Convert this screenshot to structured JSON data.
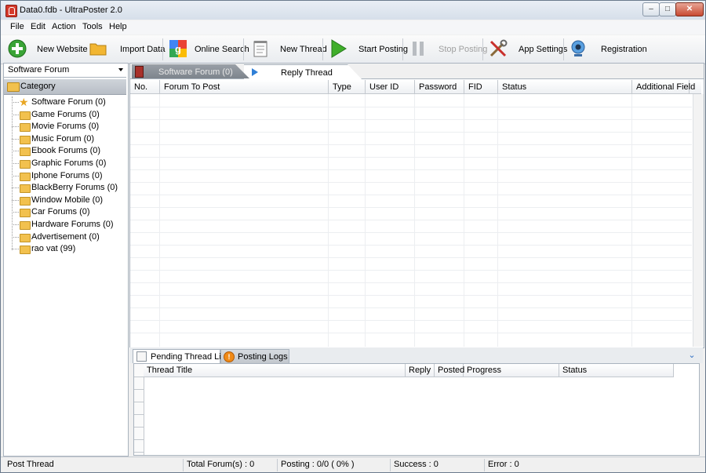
{
  "window": {
    "title": "Data0.fdb - UltraPoster 2.0",
    "min": "–",
    "max": "□",
    "close": "✕"
  },
  "menu": [
    "File",
    "Edit",
    "Action",
    "Tools",
    "Help"
  ],
  "toolbar": {
    "new_website": "New Website",
    "import_data": "Import Data",
    "online_search": "Online Search",
    "new_thread": "New Thread",
    "start_posting": "Start Posting",
    "stop_posting": "Stop Posting",
    "app_settings": "App Settings",
    "registration": "Registration"
  },
  "sidebar": {
    "selected_forum": "Software Forum",
    "category_title": "Category",
    "items": [
      {
        "label": "Software Forum (0)",
        "icon": "star-icon"
      },
      {
        "label": "Game Forums (0)",
        "icon": "folder-icon"
      },
      {
        "label": "Movie Forums (0)",
        "icon": "folder-icon"
      },
      {
        "label": "Music Forum (0)",
        "icon": "folder-icon"
      },
      {
        "label": "Ebook Forums (0)",
        "icon": "folder-icon"
      },
      {
        "label": "Graphic Forums (0)",
        "icon": "folder-icon"
      },
      {
        "label": "Iphone Forums (0)",
        "icon": "folder-icon"
      },
      {
        "label": "BlackBerry Forums (0)",
        "icon": "folder-icon"
      },
      {
        "label": "Window Mobile (0)",
        "icon": "folder-icon"
      },
      {
        "label": "Car Forums (0)",
        "icon": "folder-icon"
      },
      {
        "label": "Hardware Forums (0)",
        "icon": "folder-icon"
      },
      {
        "label": "Advertisement (0)",
        "icon": "folder-icon"
      },
      {
        "label": "rao vat (99)",
        "icon": "folder-icon"
      }
    ]
  },
  "main": {
    "tabs": [
      {
        "label": "Software Forum (0)"
      },
      {
        "label": "Reply Thread"
      }
    ],
    "columns": [
      "No.",
      "Forum To Post",
      "Type",
      "User ID",
      "Password",
      "FID",
      "Status",
      "Additional Field"
    ]
  },
  "bottom": {
    "tabs": [
      {
        "label": "Pending Thread List"
      },
      {
        "label": "Posting Logs"
      }
    ],
    "columns": [
      "Thread Title",
      "Reply",
      "Posted",
      "Progress",
      "Status"
    ]
  },
  "status": {
    "mode": "Post Thread",
    "total_forums": "Total Forum(s) : 0",
    "posting": "Posting : 0/0 ( 0% )",
    "success": "Success : 0",
    "error": "Error : 0"
  },
  "colors": {
    "accent": "#2f7fd6",
    "folder": "#f2c14e"
  }
}
